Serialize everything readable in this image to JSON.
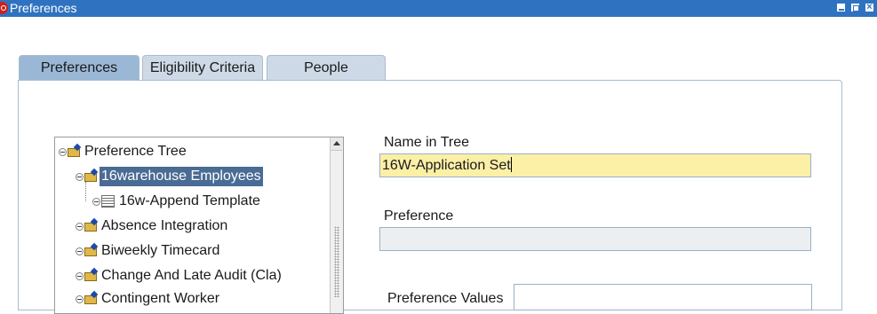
{
  "window": {
    "title": "Preferences",
    "minimize_label": "",
    "maximize_label": "",
    "close_label": "×"
  },
  "tabs": [
    {
      "label": "Preferences",
      "active": true
    },
    {
      "label": "Eligibility Criteria",
      "active": false
    },
    {
      "label": "People",
      "active": false
    }
  ],
  "tree": {
    "nodes": [
      {
        "label": "Preference Tree",
        "icon": "folder-open-icon"
      },
      {
        "label": "16warehouse Employees",
        "icon": "folder-open-icon",
        "selected": true
      },
      {
        "label": "16w-Append Template",
        "icon": "document-icon"
      },
      {
        "label": "Absence Integration",
        "icon": "folder-icon"
      },
      {
        "label": "Biweekly Timecard",
        "icon": "folder-icon"
      },
      {
        "label": "Change And Late Audit (Cla)",
        "icon": "folder-icon"
      },
      {
        "label": "Contingent Worker",
        "icon": "folder-icon"
      }
    ]
  },
  "form": {
    "name_in_tree_label": "Name in Tree",
    "name_in_tree_value": "16W-Application Set",
    "preference_label": "Preference",
    "preference_value": "",
    "preference_values_label": "Preference Values",
    "preference_values_value": ""
  },
  "colors": {
    "titlebar": "#2f73c0",
    "active_tab": "#9ab8d6",
    "inactive_tab": "#cdd9e6",
    "selected_node": "#4a6b94",
    "focused_field": "#fcefa6"
  }
}
